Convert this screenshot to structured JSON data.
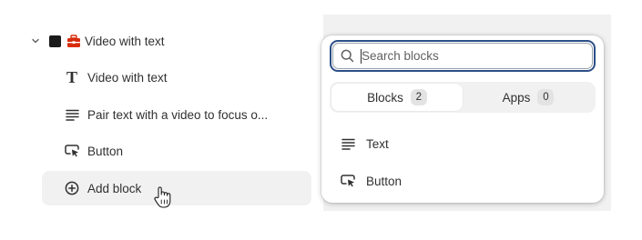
{
  "tree": {
    "section_label": "Video with text",
    "children": [
      {
        "icon": "text-heading-icon",
        "label": "Video with text"
      },
      {
        "icon": "text-lines-icon",
        "label": "Pair text with a video to focus o..."
      },
      {
        "icon": "button-cursor-icon",
        "label": "Button"
      }
    ],
    "add_block_label": "Add block"
  },
  "popover": {
    "search": {
      "placeholder": "Search blocks",
      "value": ""
    },
    "tabs": [
      {
        "label": "Blocks",
        "count": "2",
        "active": true
      },
      {
        "label": "Apps",
        "count": "0",
        "active": false
      }
    ],
    "items": [
      {
        "icon": "text-lines-icon",
        "label": "Text"
      },
      {
        "icon": "button-cursor-icon",
        "label": "Button"
      }
    ]
  },
  "colors": {
    "focus_ring": "#2c4f87",
    "briefcase_red": "#d82c0d",
    "panel_bg": "#f1f1f1"
  }
}
